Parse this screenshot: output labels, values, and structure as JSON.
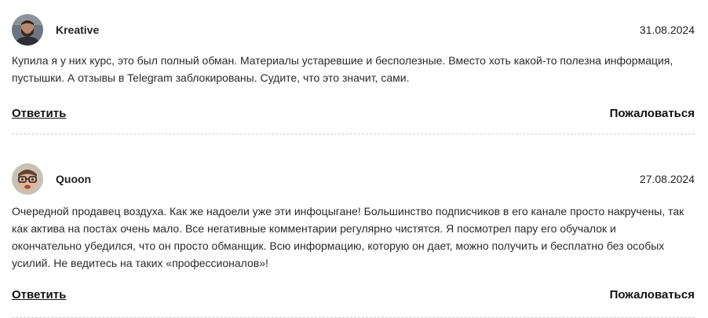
{
  "comments": [
    {
      "author": "Kreative",
      "date": "31.08.2024",
      "avatar": "avatar-man-beard",
      "text": "Купила я у них курс, это был полный обман. Материалы устаревшие и бесполезные. Вместо хоть какой-то полезна информация, пустышки. А отзывы в Telegram заблокированы. Судите, что это значит, сами.",
      "reply_label": "Ответить",
      "report_label": "Пожаловаться"
    },
    {
      "author": "Quoon",
      "date": "27.08.2024",
      "avatar": "avatar-man-glasses",
      "text": "Очередной продавец воздуха. Как же надоели уже эти инфоцыгане! Большинство подписчиков в его канале просто накручены, так как актива на постах очень мало. Все негативные комментарии регулярно чистятся. Я посмотрел пару его обучалок и окончательно убедился, что он просто обманщик. Всю информацию, которую он дает, можно получить и бесплатно без особых усилий. Не ведитесь на таких «профессионалов»!",
      "reply_label": "Ответить",
      "report_label": "Пожаловаться"
    }
  ]
}
